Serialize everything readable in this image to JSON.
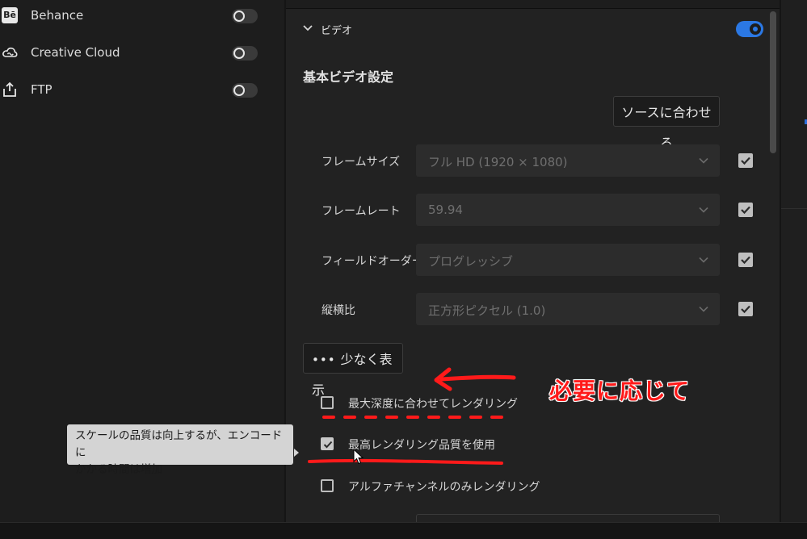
{
  "destinations": [
    {
      "icon": "behance-icon",
      "icon_text": "Bē",
      "label": "Behance",
      "enabled": false
    },
    {
      "icon": "creative-cloud-icon",
      "label": "Creative Cloud",
      "enabled": false
    },
    {
      "icon": "upload-icon",
      "label": "FTP",
      "enabled": false
    }
  ],
  "video": {
    "section_title": "ビデオ",
    "enabled": true,
    "subheading": "基本ビデオ設定",
    "match_source_button": "ソースに合わせる",
    "fields": [
      {
        "label": "フレームサイズ",
        "value": "フル HD (1920 × 1080)",
        "checked": true
      },
      {
        "label": "フレームレート",
        "value": "59.94",
        "checked": true
      },
      {
        "label": "フィールドオーダー",
        "value": "プログレッシブ",
        "checked": true
      },
      {
        "label": "縦横比",
        "value": "正方形ピクセル (1.0)",
        "checked": true
      }
    ],
    "show_less_button": "少なく表示",
    "show_less_dots": "•••",
    "checkboxes": [
      {
        "label": "最大深度に合わせてレンダリング",
        "checked": false
      },
      {
        "label": "最高レンダリング品質を使用",
        "checked": true
      },
      {
        "label": "アルファチャンネルのみレンダリング",
        "checked": false
      }
    ]
  },
  "tooltip": {
    "line1": "スケールの品質は向上するが、エンコードに",
    "line2": "かかる時間は増加"
  },
  "annotation": {
    "text": "必要に応じて",
    "color": "#ff1a1a"
  },
  "colors": {
    "accent": "#2b78e4",
    "panel_bg": "#222222",
    "left_bg": "#1d1d1d"
  }
}
